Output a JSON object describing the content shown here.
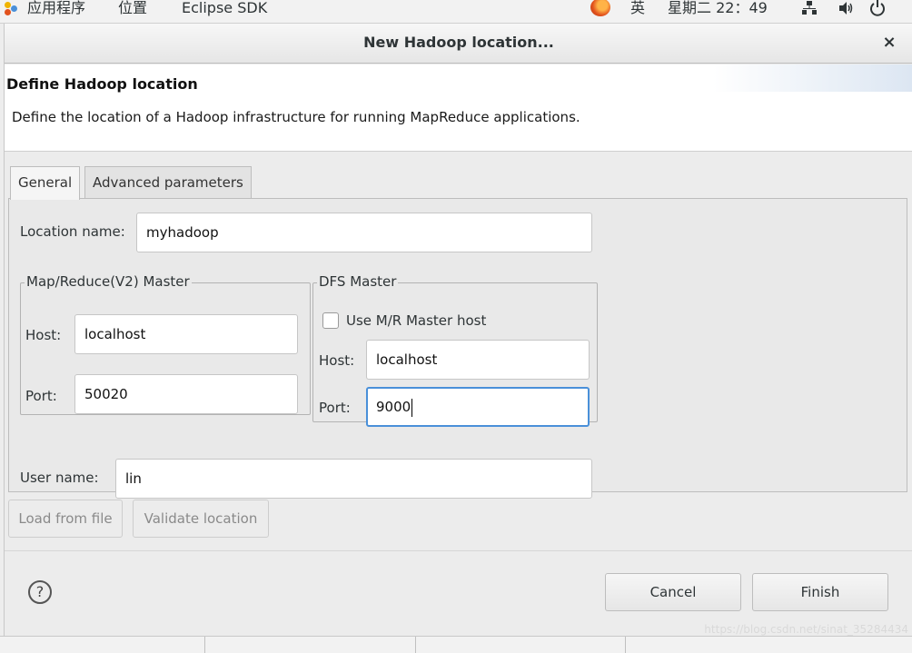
{
  "top_panel": {
    "applications": "应用程序",
    "places": "位置",
    "app_name": "Eclipse SDK",
    "input_method": "英",
    "clock": "星期二 22：49"
  },
  "dialog": {
    "title": "New Hadoop location...",
    "close_glyph": "×",
    "header_title": "Define Hadoop location",
    "header_desc": "Define the location of a Hadoop infrastructure for running MapReduce applications.",
    "tabs": [
      {
        "label": "General",
        "active": true
      },
      {
        "label": "Advanced parameters",
        "active": false
      }
    ],
    "location_name": {
      "label": "Location name:",
      "value": "myhadoop"
    },
    "mr_master": {
      "legend": "Map/Reduce(V2) Master",
      "host_label": "Host:",
      "host_value": "localhost",
      "port_label": "Port:",
      "port_value": "50020"
    },
    "dfs_master": {
      "legend": "DFS Master",
      "use_mr_host_label": "Use M/R Master host",
      "use_mr_host_checked": false,
      "host_label": "Host:",
      "host_value": "localhost",
      "port_label": "Port:",
      "port_value": "9000"
    },
    "user_name": {
      "label": "User name:",
      "value": "lin"
    },
    "load_button": "Load from file",
    "validate_button": "Validate location",
    "help_glyph": "?",
    "cancel_button": "Cancel",
    "finish_button": "Finish"
  },
  "watermark": "https://blog.csdn.net/sinat_35284434",
  "colors": {
    "focus_border": "#4a90d9",
    "dialog_bg": "#ececec"
  }
}
